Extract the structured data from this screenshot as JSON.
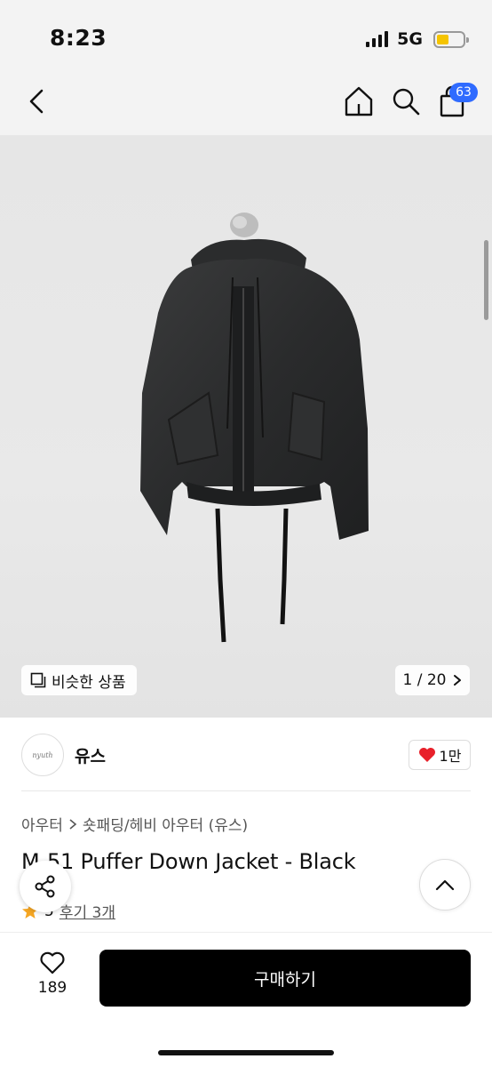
{
  "status_bar": {
    "time": "8:23",
    "network": "5G"
  },
  "nav": {
    "cart_count": "63"
  },
  "gallery": {
    "similar_label": "비슷한 상품",
    "counter": "1 / 20"
  },
  "brand": {
    "logo_text": "nyuth",
    "name": "유스",
    "likes": "1만"
  },
  "product": {
    "breadcrumb": [
      "아우터",
      "숏패딩/헤비 아우터 (유스)"
    ],
    "title": "M-51 Puffer Down Jacket - Black",
    "rating": "5",
    "reviews": "후기 3개"
  },
  "bottom": {
    "wish_count": "189",
    "buy_label": "구매하기"
  },
  "colors": {
    "badge": "#2f6bff",
    "heart": "#e8202a",
    "star": "#f5a623",
    "battery": "#f5c400"
  }
}
